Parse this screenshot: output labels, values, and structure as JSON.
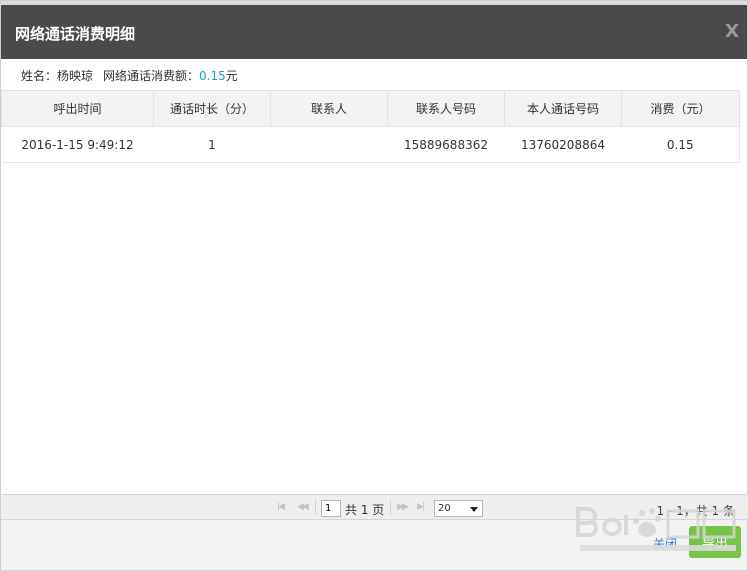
{
  "dialog": {
    "title": "网络通话消费明细",
    "close_glyph": "X"
  },
  "summary": {
    "name_label": "姓名：",
    "name_value": "杨映琼",
    "amount_label": "网络通话消费额：",
    "amount_value": "0.15",
    "amount_unit": "元"
  },
  "table": {
    "columns": [
      "呼出时间",
      "通话时长（分）",
      "联系人",
      "联系人号码",
      "本人通话号码",
      "消费（元）"
    ],
    "rows": [
      [
        "2016-1-15 9:49:12",
        "1",
        "",
        "15889688362",
        "13760208864",
        "0.15"
      ]
    ]
  },
  "pager": {
    "first_glyph": "|◀",
    "prev_glyph": "◀◀",
    "page_value": "1",
    "total_pages_text": "共 1 页",
    "next_glyph": "▶▶",
    "last_glyph": "▶|",
    "page_size": "20",
    "info_text": "1 - 1，共 1 条"
  },
  "footer": {
    "close_label": "关闭",
    "export_label": "导出"
  },
  "colors": {
    "titlebar": "#4a4a4a",
    "amount": "#1a9fd8",
    "export_button": "#77c44b"
  }
}
